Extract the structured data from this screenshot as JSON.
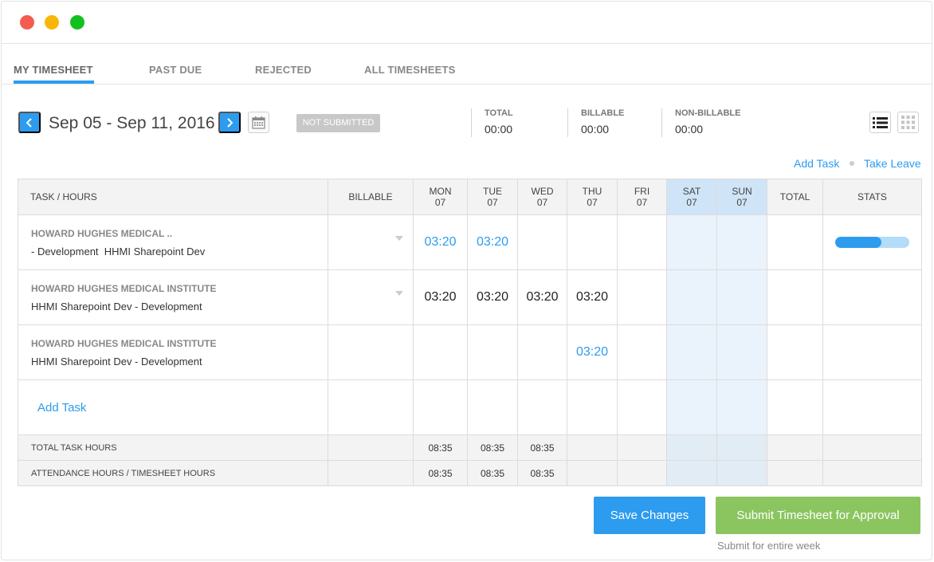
{
  "tabs": [
    {
      "label": "MY TIMESHEET",
      "active": true
    },
    {
      "label": "PAST DUE",
      "active": false
    },
    {
      "label": "REJECTED",
      "active": false
    },
    {
      "label": "ALL TIMESHEETS",
      "active": false
    }
  ],
  "week": {
    "range": "Sep 05 - Sep 11, 2016",
    "status": "NOT SUBMITTED"
  },
  "summary": {
    "total_label": "TOTAL",
    "total_value": "00:00",
    "billable_label": "BILLABLE",
    "billable_value": "00:00",
    "nonbillable_label": "NON-BILLABLE",
    "nonbillable_value": "00:00"
  },
  "links": {
    "add_task": "Add Task",
    "take_leave": "Take Leave"
  },
  "table": {
    "headers": {
      "task": "TASK / HOURS",
      "billable": "BILLABLE",
      "days": [
        {
          "day": "MON",
          "date": "07"
        },
        {
          "day": "TUE",
          "date": "07"
        },
        {
          "day": "WED",
          "date": "07"
        },
        {
          "day": "THU",
          "date": "07"
        },
        {
          "day": "FRI",
          "date": "07"
        },
        {
          "day": "SAT",
          "date": "07"
        },
        {
          "day": "SUN",
          "date": "07"
        }
      ],
      "total": "TOTAL",
      "stats": "STATS"
    },
    "rows": [
      {
        "client": "HOWARD HUGHES MEDICAL ..",
        "project_prefix": " - Development",
        "project": "HHMI Sharepoint Dev",
        "hours": [
          "03:20",
          "03:20",
          "",
          "",
          "",
          "",
          ""
        ],
        "stats_progress": 0.62
      },
      {
        "client": "HOWARD HUGHES MEDICAL INSTITUTE",
        "project": "HHMI Sharepoint Dev - Development",
        "hours": [
          "03:20",
          "03:20",
          "03:20",
          "03:20",
          "",
          "",
          ""
        ]
      },
      {
        "client": "HOWARD HUGHES MEDICAL INSTITUTE",
        "project": "HHMI Sharepoint Dev - Development",
        "hours": [
          "",
          "",
          "",
          "03:20",
          "",
          "",
          ""
        ]
      }
    ],
    "add_task": "Add Task",
    "totals": {
      "label": "TOTAL TASK HOURS",
      "values": [
        "08:35",
        "08:35",
        "08:35",
        "",
        "",
        "",
        ""
      ]
    },
    "attendance": {
      "label": "ATTENDANCE HOURS / TIMESHEET HOURS",
      "values": [
        "08:35",
        "08:35",
        "08:35",
        "",
        "",
        "",
        ""
      ]
    }
  },
  "actions": {
    "save": "Save Changes",
    "submit": "Submit Timesheet for Approval",
    "submit_note": "Submit for entire week"
  },
  "colors": {
    "accent": "#2d9cef",
    "submit": "#8bc560",
    "weekend_header": "#cfe4f6",
    "weekend_cell": "#eaf3fb"
  }
}
